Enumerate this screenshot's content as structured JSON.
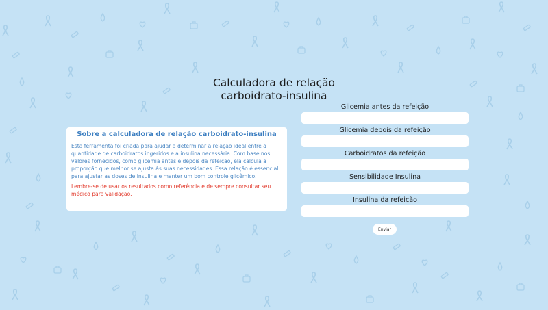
{
  "header": {
    "title_line1": "Calculadora de relação",
    "title_line2": "carboidrato-insulina"
  },
  "info": {
    "title": "Sobre a calculadora de relação carboidrato-insulina",
    "body": "Esta ferramenta foi criada para ajudar a determinar a relação ideal entre a quantidade de carboidratos ingeridos e a insulina necessária. Com base nos valores fornecidos, como glicemia antes e depois da refeição, ela calcula a proporção que melhor se ajusta às suas necessidades. Essa relação é essencial para ajustar as doses de insulina e manter um bom controle glicêmico.",
    "warning": "Lembre-se de usar os resultados como referência e de sempre consultar seu médico para validação."
  },
  "form": {
    "fields": [
      {
        "label": "Glicemia antes da refeição",
        "value": ""
      },
      {
        "label": "Glicemia depois da refeição",
        "value": ""
      },
      {
        "label": "Carboidratos da refeição",
        "value": ""
      },
      {
        "label": "Sensibilidade Insulina",
        "value": ""
      },
      {
        "label": "Insulina da refeição",
        "value": ""
      }
    ],
    "submit_label": "Enviar"
  },
  "colors": {
    "background": "#c5e2f5",
    "pattern": "#a8cfe9",
    "info_title": "#3d7fc1",
    "info_text": "#4b87c3",
    "warning": "#e23a2c"
  },
  "background_icons": [
    "awareness-ribbon-icon",
    "blood-drop-icon",
    "syringe-icon",
    "medical-bag-icon",
    "heart-icon",
    "book-icon"
  ]
}
